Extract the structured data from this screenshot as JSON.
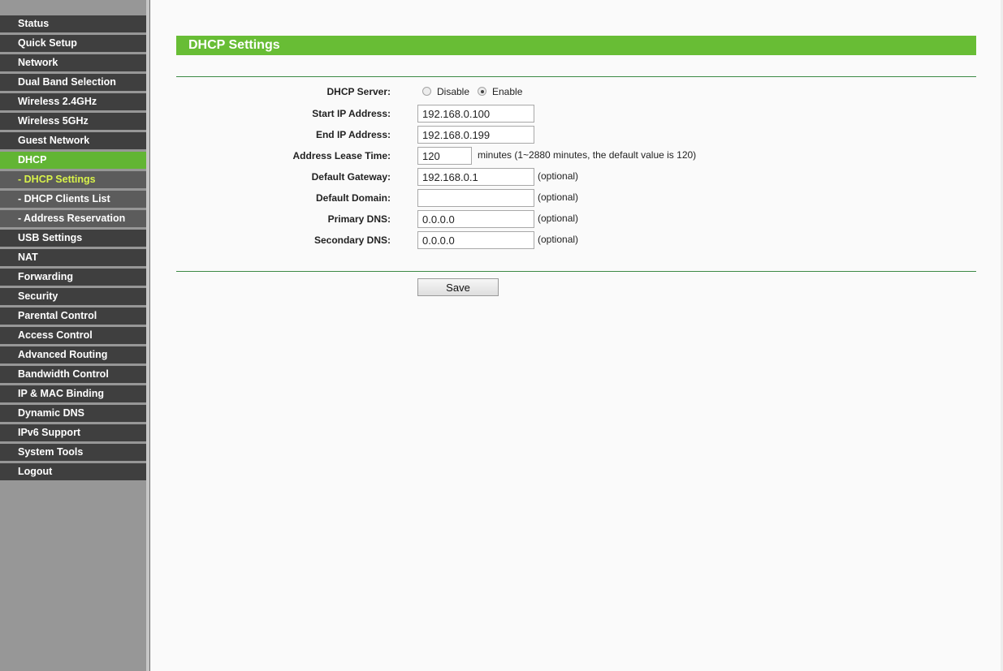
{
  "sidebar": {
    "items": [
      {
        "label": "Status"
      },
      {
        "label": "Quick Setup"
      },
      {
        "label": "Network"
      },
      {
        "label": "Dual Band Selection"
      },
      {
        "label": "Wireless 2.4GHz"
      },
      {
        "label": "Wireless 5GHz"
      },
      {
        "label": "Guest Network"
      },
      {
        "label": "DHCP"
      },
      {
        "label": "- DHCP Settings"
      },
      {
        "label": "- DHCP Clients List"
      },
      {
        "label": "- Address Reservation"
      },
      {
        "label": "USB Settings"
      },
      {
        "label": "NAT"
      },
      {
        "label": "Forwarding"
      },
      {
        "label": "Security"
      },
      {
        "label": "Parental Control"
      },
      {
        "label": "Access Control"
      },
      {
        "label": "Advanced Routing"
      },
      {
        "label": "Bandwidth Control"
      },
      {
        "label": "IP & MAC Binding"
      },
      {
        "label": "Dynamic DNS"
      },
      {
        "label": "IPv6 Support"
      },
      {
        "label": "System Tools"
      },
      {
        "label": "Logout"
      }
    ]
  },
  "page": {
    "title": "DHCP Settings"
  },
  "form": {
    "dhcp_server": {
      "label": "DHCP Server:",
      "options": {
        "disable": "Disable",
        "enable": "Enable"
      },
      "selected": "Enable"
    },
    "start_ip": {
      "label": "Start IP Address:",
      "value": "192.168.0.100"
    },
    "end_ip": {
      "label": "End IP Address:",
      "value": "192.168.0.199"
    },
    "lease_time": {
      "label": "Address Lease Time:",
      "value": "120",
      "hint": "minutes (1~2880 minutes, the default value is 120)"
    },
    "gateway": {
      "label": "Default Gateway:",
      "value": "192.168.0.1",
      "hint": "(optional)"
    },
    "domain": {
      "label": "Default Domain:",
      "value": "",
      "hint": "(optional)"
    },
    "primary_dns": {
      "label": "Primary DNS:",
      "value": "0.0.0.0",
      "hint": "(optional)"
    },
    "secondary_dns": {
      "label": "Secondary DNS:",
      "value": "0.0.0.0",
      "hint": "(optional)"
    }
  },
  "actions": {
    "save_label": "Save"
  },
  "colors": {
    "accent_green": "#68bd35",
    "menu_dark": "#3f3f3f",
    "menu_sub": "#5c5c5c",
    "submenu_active_text": "#d8f24a"
  }
}
